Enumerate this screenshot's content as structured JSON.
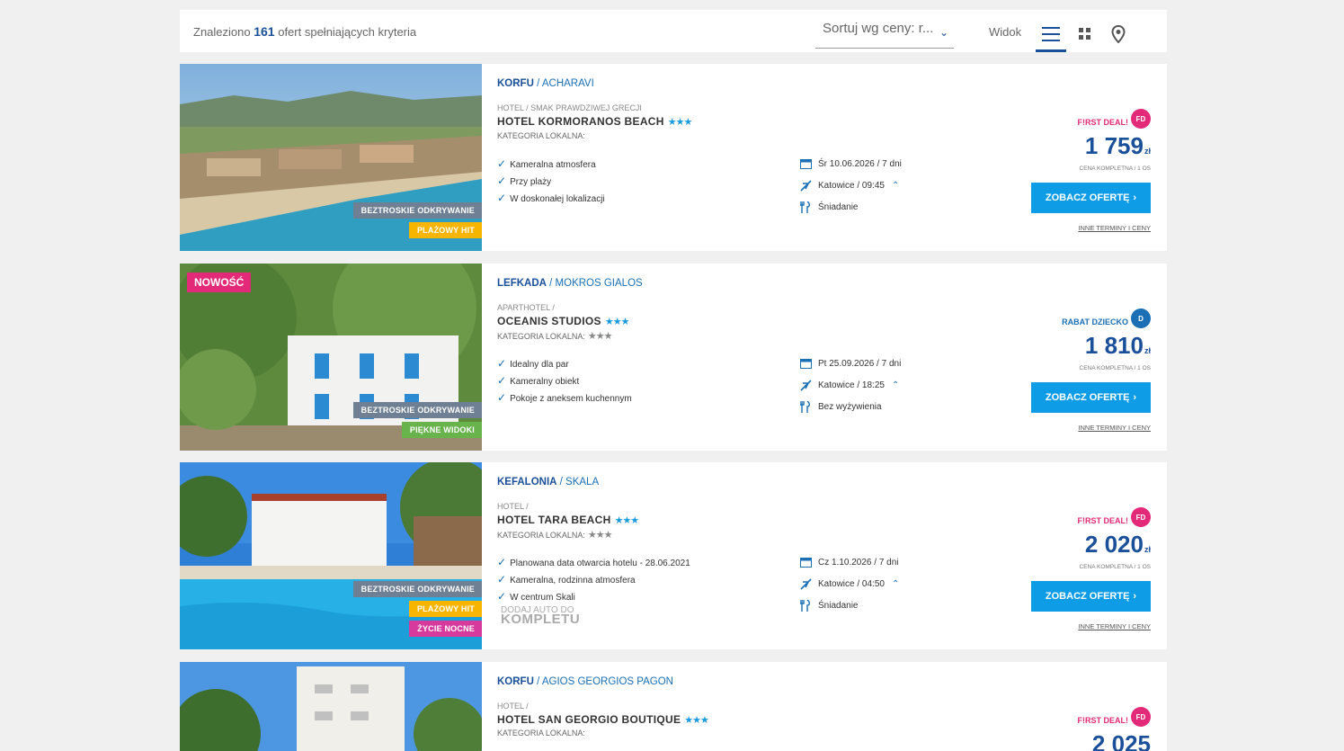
{
  "header": {
    "found_prefix": "Znaleziono",
    "found_count": "161",
    "found_suffix": "ofert spełniających kryteria",
    "sort_label": "Sortuj wg ceny: r...",
    "view_label": "Widok",
    "view_options": [
      "list-icon",
      "grid-icon",
      "map-pin-icon"
    ]
  },
  "offers": [
    {
      "region": "KORFU",
      "place": "ACHARAVI",
      "type": "HOTEL / SMAK PRAWDZIWEJ GRECJI",
      "name": "HOTEL KORMORANOS BEACH",
      "stars": "★★★",
      "local_cat": "KATEGORIA LOKALNA:",
      "local_stars": "",
      "features": [
        "Kameralna atmosfera",
        "Przy plaży",
        "W doskonałej lokalizacji"
      ],
      "date": "Śr 10.06.2026 / 7 dni",
      "departure": "Katowice / 09:45",
      "board": "Śniadanie",
      "badge_label": "F!RST DEAL!",
      "badge_code": "FD",
      "badge_color": "#e22a78",
      "price": "1 759",
      "currency": "zł",
      "price_note": "CENA KOMPLETNA / 1 OS",
      "cta": "ZOBACZ OFERTĘ",
      "other": "INNE TERMINY I CENY",
      "tags": [
        "BEZTROSKIE ODKRYWANIE",
        "PLAŻOWY HIT"
      ],
      "new_label": ""
    },
    {
      "region": "LEFKADA",
      "place": "MOKROS GIALOS",
      "type": "APARTHOTEL /",
      "name": "OCEANIS STUDIOS",
      "stars": "★★★",
      "local_cat": "KATEGORIA LOKALNA:",
      "local_stars": "★★★",
      "features": [
        "Idealny dla par",
        "Kameralny obiekt",
        "Pokoje z aneksem kuchennym"
      ],
      "date": "Pt 25.09.2026 / 7 dni",
      "departure": "Katowice / 18:25",
      "board": "Bez wyżywienia",
      "badge_label": "RABAT DZIECKO",
      "badge_code": "D",
      "badge_color": "#1a6fb5",
      "price": "1 810",
      "currency": "zł",
      "price_note": "CENA KOMPLETNA / 1 OS",
      "cta": "ZOBACZ OFERTĘ",
      "other": "INNE TERMINY I CENY",
      "tags": [
        "BEZTROSKIE ODKRYWANIE",
        "PIĘKNE WIDOKI"
      ],
      "new_label": "NOWOŚĆ"
    },
    {
      "region": "KEFALONIA",
      "place": "SKALA",
      "type": "HOTEL /",
      "name": "HOTEL TARA BEACH",
      "stars": "★★★",
      "local_cat": "KATEGORIA LOKALNA:",
      "local_stars": "★★★",
      "features": [
        "Planowana data otwarcia hotelu - 28.06.2021",
        "Kameralna, rodzinna atmosfera",
        "W centrum Skali"
      ],
      "add_car_small": "DODAJ AUTO DO",
      "add_car_big": "KOMPLETU",
      "date": "Cz 1.10.2026 / 7 dni",
      "departure": "Katowice / 04:50",
      "board": "Śniadanie",
      "badge_label": "F!RST DEAL!",
      "badge_code": "FD",
      "badge_color": "#e22a78",
      "price": "2 020",
      "currency": "zł",
      "price_note": "CENA KOMPLETNA / 1 OS",
      "cta": "ZOBACZ OFERTĘ",
      "other": "INNE TERMINY I CENY",
      "tags": [
        "BEZTROSKIE ODKRYWANIE",
        "PLAŻOWY HIT",
        "ŻYCIE NOCNE"
      ],
      "new_label": ""
    },
    {
      "region": "KORFU",
      "place": "AGIOS GEORGIOS PAGON",
      "type": "HOTEL /",
      "name": "HOTEL SAN GEORGIO BOUTIQUE",
      "stars": "★★★",
      "local_cat": "KATEGORIA LOKALNA:",
      "badge_label": "F!RST DEAL!",
      "badge_code": "FD",
      "badge_color": "#e22a78",
      "price": "2 025"
    }
  ]
}
